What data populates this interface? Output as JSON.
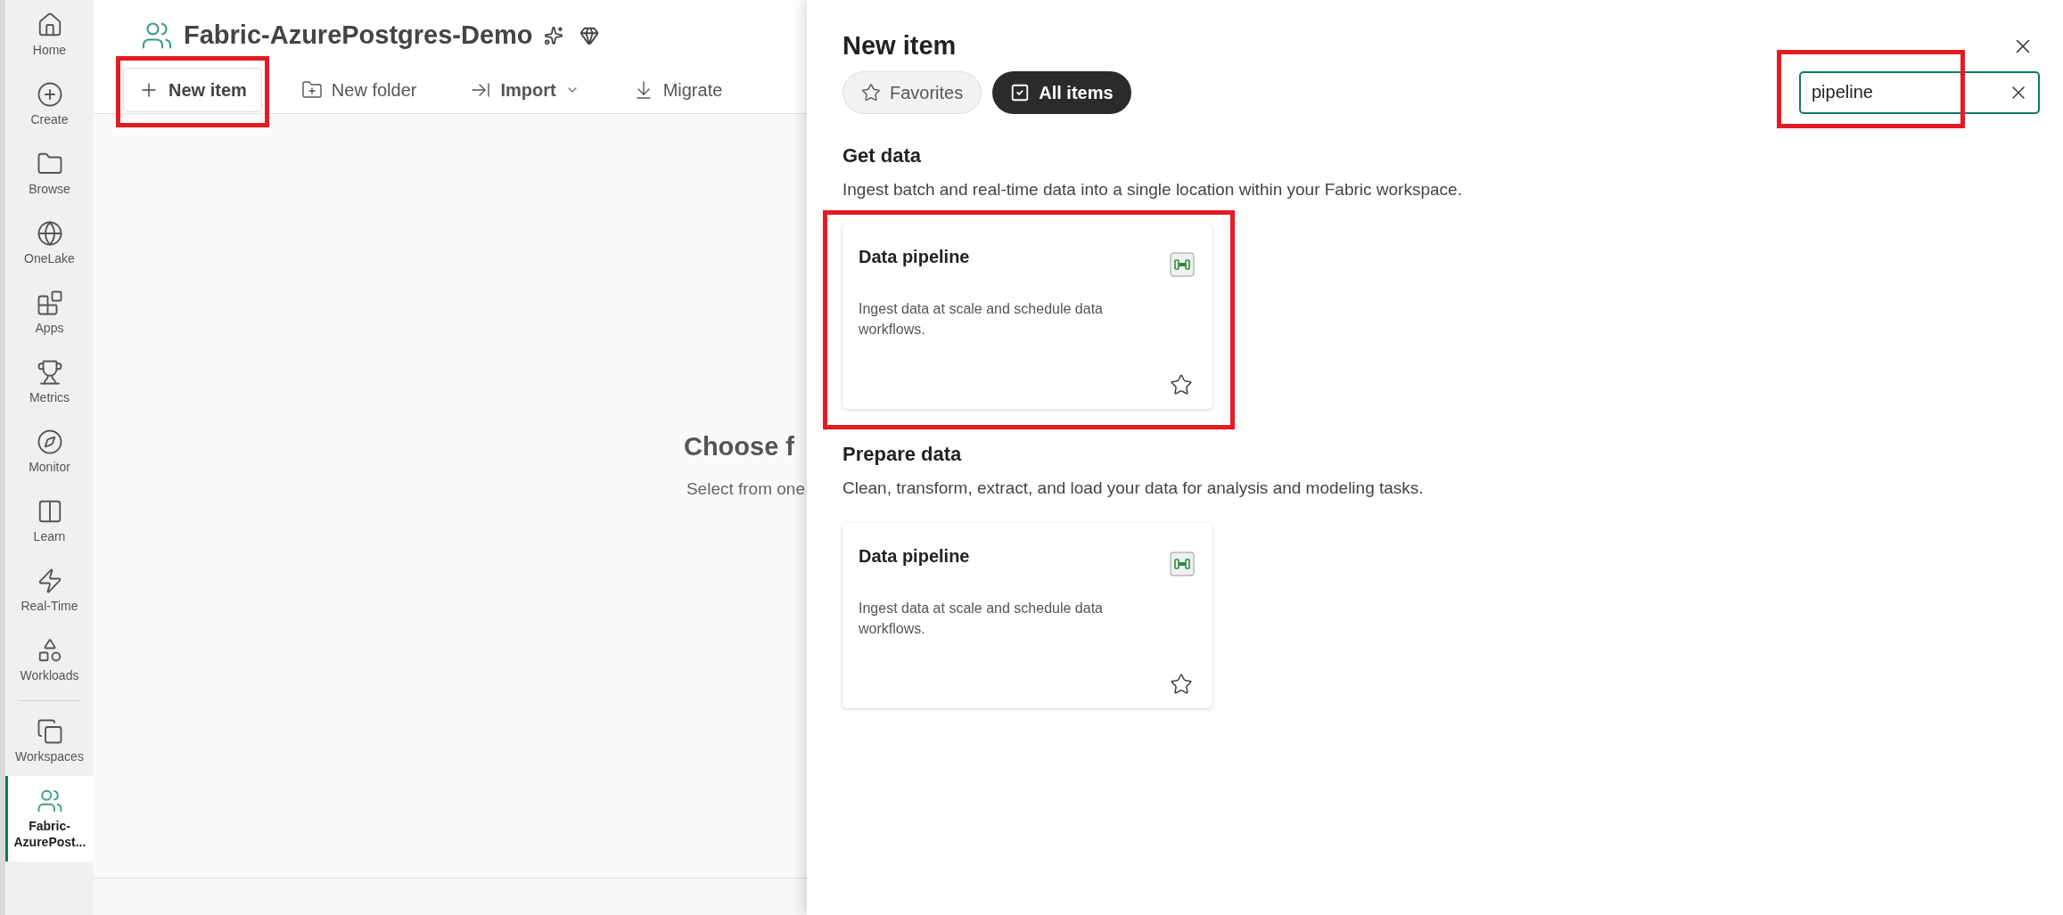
{
  "nav_apps": [
    {
      "label": "Home",
      "selected": false
    },
    {
      "label": "Create",
      "selected": false
    },
    {
      "label": "Browse",
      "selected": false
    },
    {
      "label": "OneLake",
      "selected": false
    },
    {
      "label": "Apps",
      "selected": false
    },
    {
      "label": "Metrics",
      "selected": false
    },
    {
      "label": "Monitor",
      "selected": false
    },
    {
      "label": "Learn",
      "selected": false
    },
    {
      "label": "Real-Time",
      "selected": false
    },
    {
      "label": "Workloads",
      "selected": false
    }
  ],
  "nav_workspaces": [
    {
      "label": "Workspaces",
      "selected": false
    },
    {
      "label": "Fabric-AzurePost...",
      "selected": true
    }
  ],
  "workspace": {
    "title": "Fabric-AzurePostgres-Demo"
  },
  "toolbar": [
    {
      "label": "New item",
      "dropdown": false,
      "highlighted": true
    },
    {
      "label": "New folder",
      "dropdown": false,
      "highlighted": false
    },
    {
      "label": "Import",
      "dropdown": true,
      "highlighted": false
    },
    {
      "label": "Migrate",
      "dropdown": false,
      "highlighted": false
    }
  ],
  "main": {
    "heading": "Choose f",
    "subtext": "Select from one"
  },
  "panel": {
    "title": "New item",
    "filters": [
      {
        "label": "Favorites",
        "selected": false
      },
      {
        "label": "All items",
        "selected": true
      }
    ],
    "search": {
      "value": "pipeline",
      "highlighted": true
    },
    "sections": [
      {
        "heading": "Get data",
        "description": "Ingest batch and real-time data into a single location within your Fabric workspace.",
        "items": [
          {
            "title": "Data pipeline",
            "description": "Ingest data at scale and schedule data workflows.",
            "favorite": false,
            "highlighted": true
          }
        ]
      },
      {
        "heading": "Prepare data",
        "description": "Clean, transform, extract, and load your data for analysis and modeling tasks.",
        "items": [
          {
            "title": "Data pipeline",
            "description": "Ingest data at scale and schedule data workflows.",
            "favorite": false,
            "highlighted": false
          }
        ]
      }
    ]
  }
}
